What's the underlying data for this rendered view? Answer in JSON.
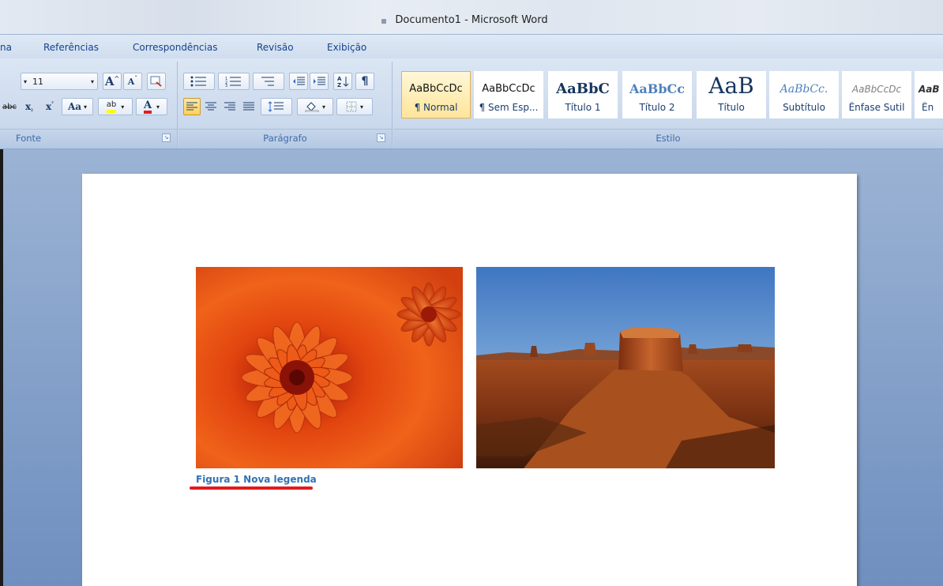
{
  "window": {
    "title": "Documento1 - Microsoft Word"
  },
  "ribbon_tabs": [
    {
      "label": "na"
    },
    {
      "label": "Referências"
    },
    {
      "label": "Correspondências"
    },
    {
      "label": "Revisão"
    },
    {
      "label": "Exibição"
    }
  ],
  "font_group": {
    "label": "Fonte",
    "font_size": "11",
    "grow_font": "A",
    "shrink_font": "A",
    "change_case": "Aa",
    "highlight": "ab",
    "font_color": "A",
    "strikethrough": "abc",
    "subscript": "x",
    "superscript": "x"
  },
  "paragraph_group": {
    "label": "Parágrafo",
    "show_marks": "¶"
  },
  "styles_group": {
    "label": "Estilo",
    "items": [
      {
        "sample": "AaBbCcDc",
        "name": "¶ Normal"
      },
      {
        "sample": "AaBbCcDc",
        "name": "¶ Sem Esp..."
      },
      {
        "sample": "AaBbC",
        "name": "Título 1"
      },
      {
        "sample": "AaBbCc",
        "name": "Título 2"
      },
      {
        "sample": "AaB",
        "name": "Título"
      },
      {
        "sample": "AaBbCc.",
        "name": "Subtítulo"
      },
      {
        "sample": "AaBbCcDc",
        "name": "Ênfase Sutil"
      },
      {
        "sample": "AaB",
        "name": "Ên"
      }
    ]
  },
  "document": {
    "caption": "Figura 1 Nova legenda"
  },
  "colors": {
    "caption_text": "#2e74b5",
    "underline_annotation": "#e31b1b",
    "selected_style": "#ffe59a"
  }
}
